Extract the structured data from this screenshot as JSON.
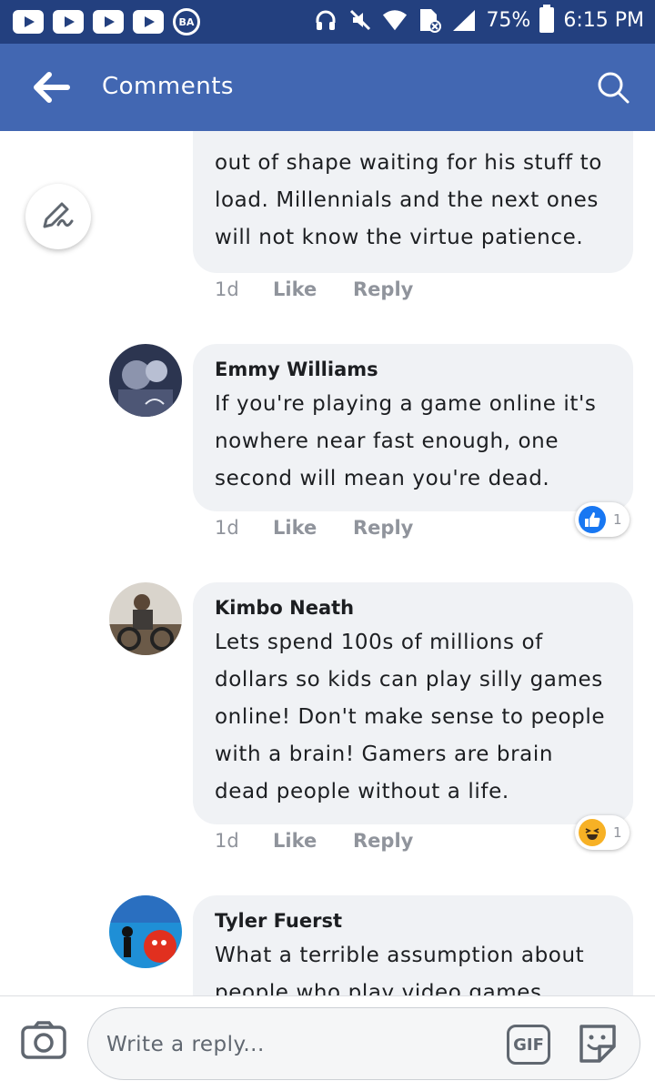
{
  "status_bar": {
    "battery": "75%",
    "time": "6:15 PM",
    "badge": "BA"
  },
  "header": {
    "title": "Comments"
  },
  "comments": [
    {
      "author": "",
      "text": "out of shape waiting for his stuff to load. Millennials and the next ones will not know the virtue patience.",
      "time": "1d",
      "like_label": "Like",
      "reply_label": "Reply"
    },
    {
      "author": "Emmy Williams",
      "text": "If you're playing a game online it's nowhere near fast enough, one second will mean you're dead.",
      "time": "1d",
      "like_label": "Like",
      "reply_label": "Reply",
      "reaction": {
        "icon": "thumbs-up-icon",
        "count": "1",
        "color": "#1877f2"
      }
    },
    {
      "author": "Kimbo Neath",
      "text": "Lets spend 100s of millions of dollars so kids can play silly games online! Don't make sense to people with a brain! Gamers are brain dead people without a life.",
      "time": "1d",
      "like_label": "Like",
      "reply_label": "Reply",
      "reaction": {
        "icon": "haha-icon",
        "count": "1",
        "color": "#f7b125"
      }
    },
    {
      "author": "Tyler Fuerst",
      "text": "What a terrible assumption about people who play video games"
    }
  ],
  "composer": {
    "placeholder": "Write a reply...",
    "gif_label": "GIF"
  },
  "colors": {
    "status_bar": "#23407f",
    "app_bar": "#4267b2",
    "bubble": "#f0f2f5",
    "meta_text": "#90949c"
  }
}
